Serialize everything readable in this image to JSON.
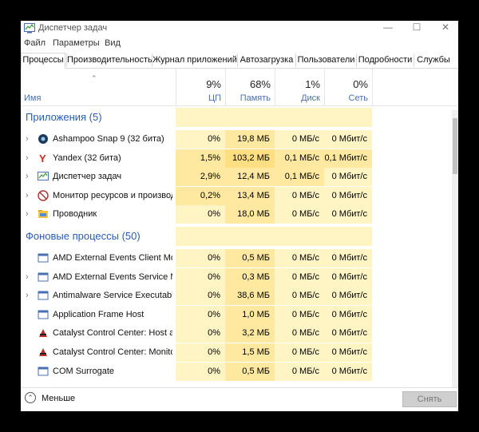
{
  "window": {
    "title": "Диспетчер задач",
    "minimize": "—",
    "maximize": "☐",
    "close": "✕"
  },
  "menu": [
    "Файл",
    "Параметры",
    "Вид"
  ],
  "tabs": [
    "Процессы",
    "Производительность",
    "Журнал приложений",
    "Автозагрузка",
    "Пользователи",
    "Подробности",
    "Службы"
  ],
  "active_tab": "Процессы",
  "columns": {
    "name": "Имя",
    "cpu": {
      "pct": "9%",
      "label": "ЦП"
    },
    "mem": {
      "pct": "68%",
      "label": "Память"
    },
    "disk": {
      "pct": "1%",
      "label": "Диск"
    },
    "net": {
      "pct": "0%",
      "label": "Сеть"
    }
  },
  "sections": [
    {
      "label": "Приложения (5)",
      "rows": [
        {
          "name": "Ashampoo Snap 9 (32 бита)",
          "expand": true,
          "icon": "ashampoo-icon",
          "cpu": "0%",
          "mem": "19,8 МБ",
          "disk": "0 МБ/с",
          "net": "0 Мбит/с"
        },
        {
          "name": "Yandex (32 бита)",
          "expand": true,
          "icon": "yandex-icon",
          "cpu": "1,5%",
          "mem": "103,2 МБ",
          "disk": "0,1 МБ/с",
          "net": "0,1 Мбит/с"
        },
        {
          "name": "Диспетчер задач",
          "expand": true,
          "icon": "task-manager-icon",
          "cpu": "2,9%",
          "mem": "12,4 МБ",
          "disk": "0,1 МБ/с",
          "net": "0 Мбит/с"
        },
        {
          "name": "Монитор ресурсов и производ...",
          "expand": true,
          "icon": "resource-monitor-icon",
          "cpu": "0,2%",
          "mem": "13,4 МБ",
          "disk": "0 МБ/с",
          "net": "0 Мбит/с"
        },
        {
          "name": "Проводник",
          "expand": true,
          "icon": "explorer-icon",
          "cpu": "0%",
          "mem": "18,0 МБ",
          "disk": "0 МБ/с",
          "net": "0 Мбит/с"
        }
      ]
    },
    {
      "label": "Фоновые процессы (50)",
      "rows": [
        {
          "name": "AMD External Events Client Mo...",
          "expand": false,
          "icon": "service-window-icon",
          "cpu": "0%",
          "mem": "0,5 МБ",
          "disk": "0 МБ/с",
          "net": "0 Мбит/с"
        },
        {
          "name": "AMD External Events Service M...",
          "expand": true,
          "icon": "service-window-icon",
          "cpu": "0%",
          "mem": "0,3 МБ",
          "disk": "0 МБ/с",
          "net": "0 Мбит/с"
        },
        {
          "name": "Antimalware Service Executable",
          "expand": true,
          "icon": "service-window-icon",
          "cpu": "0%",
          "mem": "38,6 МБ",
          "disk": "0 МБ/с",
          "net": "0 Мбит/с"
        },
        {
          "name": "Application Frame Host",
          "expand": false,
          "icon": "service-window-icon",
          "cpu": "0%",
          "mem": "1,0 МБ",
          "disk": "0 МБ/с",
          "net": "0 Мбит/с"
        },
        {
          "name": "Catalyst Control Center: Host a...",
          "expand": false,
          "icon": "catalyst-icon",
          "cpu": "0%",
          "mem": "3,2 МБ",
          "disk": "0 МБ/с",
          "net": "0 Мбит/с"
        },
        {
          "name": "Catalyst Control Center: Monito...",
          "expand": false,
          "icon": "catalyst-icon",
          "cpu": "0%",
          "mem": "1,5 МБ",
          "disk": "0 МБ/с",
          "net": "0 Мбит/с"
        },
        {
          "name": "COM Surrogate",
          "expand": false,
          "icon": "service-window-icon",
          "cpu": "0%",
          "mem": "0,5 МБ",
          "disk": "0 МБ/с",
          "net": "0 Мбит/с"
        }
      ]
    }
  ],
  "footer": {
    "less_label": "Меньше",
    "end_task_label": "Снять задачу"
  },
  "colors": {
    "section_text": "#2a5db5",
    "header_label": "#4a6fb0",
    "heat_light": "#fff4c4",
    "heat_mid": "#ffe9a0",
    "heat_dark": "#ffdf82"
  }
}
